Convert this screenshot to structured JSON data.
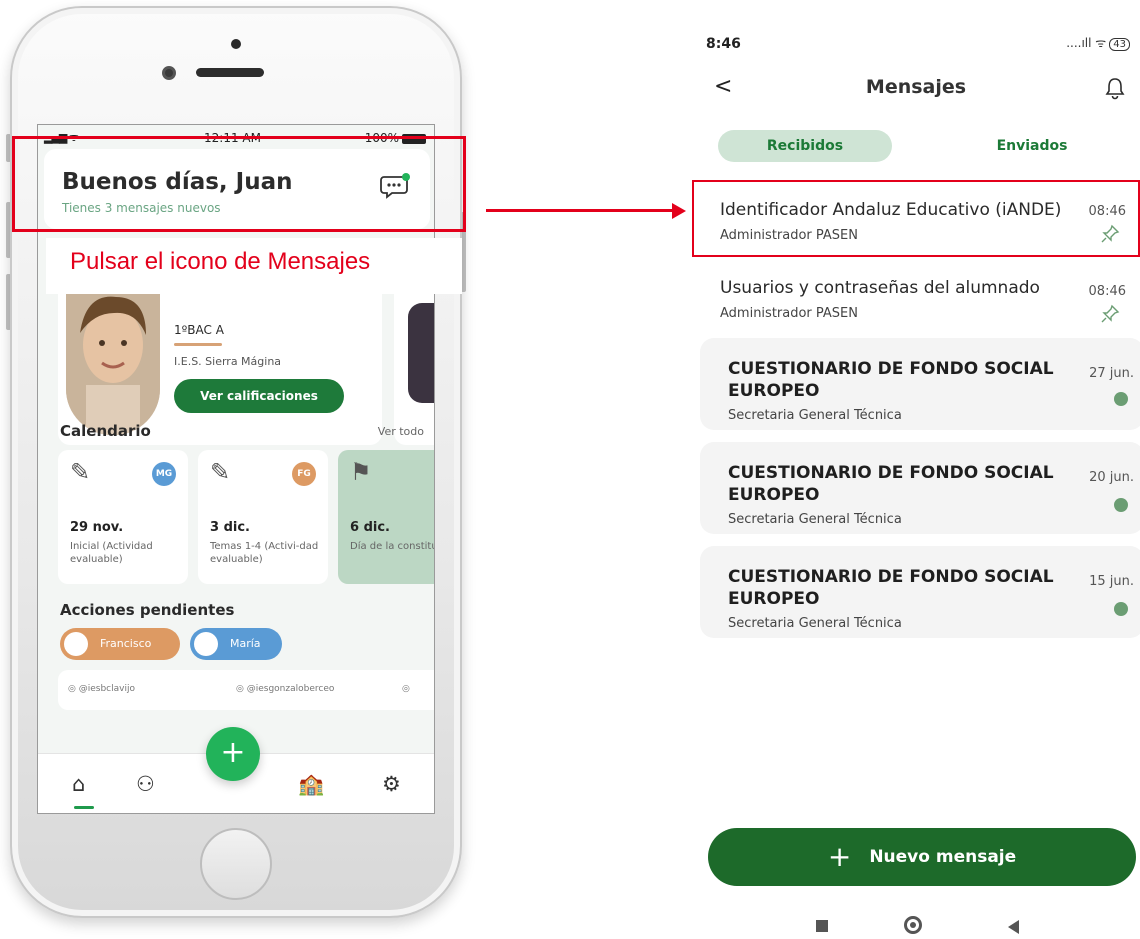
{
  "phone": {
    "status": {
      "time": "12:11 AM",
      "battery": "100%"
    },
    "greeting": {
      "title": "Buenos días, Juan",
      "subtitle": "Tienes 3 mensajes nuevos"
    },
    "student": {
      "class": "1ºBAC A",
      "school": "I.E.S. Sierra Mágina",
      "grades_button": "Ver calificaciones"
    },
    "calendar": {
      "title": "Calendario",
      "see_all": "Ver todo",
      "cards": [
        {
          "badge": "MG",
          "badge_color": "#5a9bd5",
          "date": "29 nov.",
          "desc": "Inicial (Actividad evaluable)"
        },
        {
          "badge": "FG",
          "badge_color": "#dd9a63",
          "date": "3 dic.",
          "desc": "Temas 1-4 (Activi-dad evaluable)"
        },
        {
          "badge": "",
          "badge_color": "",
          "date": "6 dic.",
          "desc": "Día de la constitución"
        }
      ]
    },
    "pending": {
      "title": "Acciones pendientes",
      "pills": [
        {
          "label": "Francisco",
          "color": "#dd9a63"
        },
        {
          "label": "María",
          "color": "#5a9bd5"
        }
      ]
    },
    "social": [
      "@iesbclavijo",
      "@iesgonzaloberceo"
    ],
    "fab_label": "+"
  },
  "callout": {
    "text": "Pulsar el icono de Mensajes",
    "color": "#e3001b"
  },
  "android": {
    "status": {
      "time": "8:46",
      "signal": "....ıll",
      "battery": "43"
    },
    "header": {
      "back": "<",
      "title": "Mensajes"
    },
    "tabs": {
      "received": "Recibidos",
      "sent": "Enviados"
    },
    "messages": [
      {
        "title": "Identificador Andaluz Educativo (iANDE)",
        "sender": "Administrador PASEN",
        "date": "08:46",
        "unread": false,
        "pinned": true
      },
      {
        "title": "Usuarios y contraseñas del alumnado",
        "sender": "Administrador PASEN",
        "date": "08:46",
        "unread": false,
        "pinned": true
      },
      {
        "title_line1": "CUESTIONARIO DE FONDO SOCIAL",
        "title_line2": "EUROPEO",
        "sender": "Secretaria General Técnica",
        "date": "27 jun.",
        "unread": true
      },
      {
        "title_line1": "CUESTIONARIO DE FONDO SOCIAL",
        "title_line2": "EUROPEO",
        "sender": "Secretaria General Técnica",
        "date": "20 jun.",
        "unread": true
      },
      {
        "title_line1": "CUESTIONARIO DE FONDO SOCIAL",
        "title_line2": "EUROPEO",
        "sender": "Secretaria General Técnica",
        "date": "15 jun.",
        "unread": true
      }
    ],
    "new_message_button": {
      "icon": "+",
      "label": "Nuevo mensaje"
    }
  },
  "colors": {
    "brand_green": "#1d6a2a",
    "accent_green": "#22b35a",
    "highlight_red": "#e3001b"
  }
}
